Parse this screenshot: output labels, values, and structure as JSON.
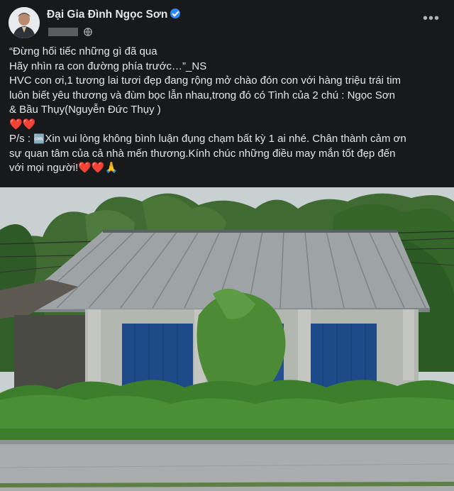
{
  "post": {
    "author": "Đại Gia Đình Ngọc Sơn",
    "verified": true,
    "timestamp_obscured": true,
    "audience_icon": "globe-icon",
    "more_icon": "more-horizontal-icon",
    "more_label": "•••",
    "caption": {
      "line1": "“Đừng hối tiếc những gì đã qua",
      "line2": "Hãy nhìn ra con đường phía trước…”_NS",
      "line3": "HVC con ơi,1 tương lai tươi đẹp đang rộng mở chào đón con với hàng triệu trái tim",
      "line4": "luôn biết  yêu thương và đùm bọc lẫn nhau,trong đó có Tình của 2 chú : Ngọc Sơn",
      "line5": "& Bầu Thụy(Nguyễn Đức Thụy )",
      "hearts": "❤️❤️",
      "line7_prefix": "P/s : ",
      "line7_emoji": "🆒",
      "line7_text": "Xin vui lòng không bình luận đụng chạm bất kỳ 1 ai nhé. Chân thành cảm ơn",
      "line8": "sự quan tâm của cả nhà mến thương.Kính chúc những điều may mắn tốt đẹp đến",
      "line9_text": "với mọi người!",
      "line9_emoji": "❤️❤️🙏"
    },
    "photo_description": "house-with-corrugated-roof-photo"
  },
  "colors": {
    "background": "#18191a",
    "text": "#e4e6eb",
    "secondary": "#b0b3b8",
    "verified": "#2d88ff"
  }
}
